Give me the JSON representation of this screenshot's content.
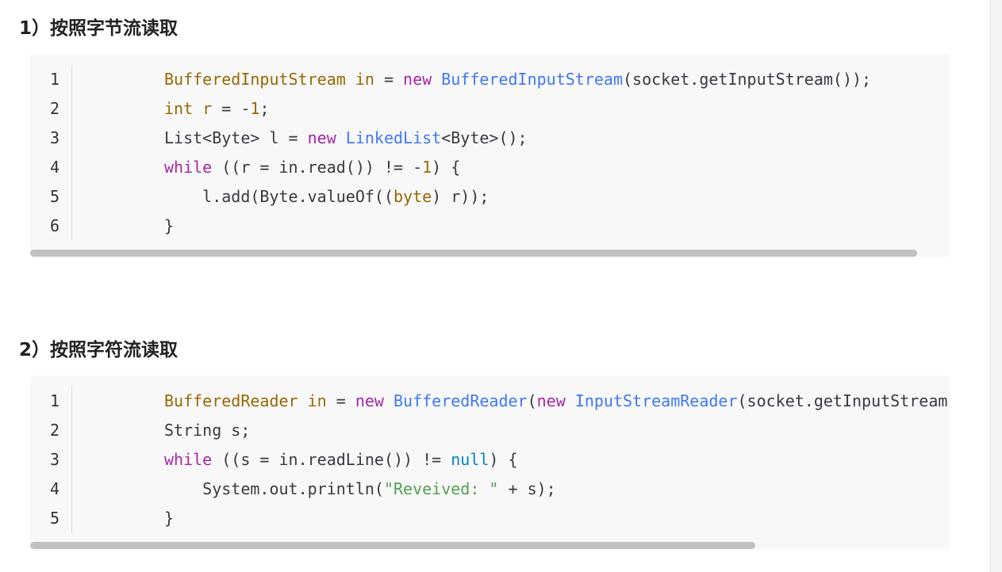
{
  "article": {
    "heading_1": "1）按照字节流读取",
    "heading_2": "2）按照字符流读取"
  },
  "code_blocks": [
    {
      "line_numbers": [
        "1",
        "2",
        "3",
        "4",
        "5",
        "6"
      ],
      "lines": [
        [
          [
            "tok-type",
            "BufferedInputStream"
          ],
          [
            "tok-plain",
            " "
          ],
          [
            "tok-var",
            "in"
          ],
          [
            "tok-plain",
            " = "
          ],
          [
            "tok-kw",
            "new"
          ],
          [
            "tok-plain",
            " "
          ],
          [
            "tok-cls",
            "BufferedInputStream"
          ],
          [
            "tok-plain",
            "(socket.getInputStream());"
          ]
        ],
        [
          [
            "tok-type",
            "int"
          ],
          [
            "tok-plain",
            " "
          ],
          [
            "tok-var",
            "r"
          ],
          [
            "tok-plain",
            " = -"
          ],
          [
            "tok-num",
            "1"
          ],
          [
            "tok-plain",
            ";"
          ]
        ],
        [
          [
            "tok-plain",
            "List<Byte> l = "
          ],
          [
            "tok-kw",
            "new"
          ],
          [
            "tok-plain",
            " "
          ],
          [
            "tok-cls",
            "LinkedList"
          ],
          [
            "tok-plain",
            "<Byte>();"
          ]
        ],
        [
          [
            "tok-kw",
            "while"
          ],
          [
            "tok-plain",
            " ((r = in.read()) != -"
          ],
          [
            "tok-num",
            "1"
          ],
          [
            "tok-plain",
            ") {"
          ]
        ],
        [
          [
            "tok-plain",
            "    l.add(Byte.valueOf(("
          ],
          [
            "tok-type",
            "byte"
          ],
          [
            "tok-plain",
            ") r));"
          ]
        ],
        [
          [
            "tok-plain",
            "}"
          ]
        ]
      ]
    },
    {
      "line_numbers": [
        "1",
        "2",
        "3",
        "4",
        "5"
      ],
      "lines": [
        [
          [
            "tok-type",
            "BufferedReader"
          ],
          [
            "tok-plain",
            " "
          ],
          [
            "tok-var",
            "in"
          ],
          [
            "tok-plain",
            " = "
          ],
          [
            "tok-kw",
            "new"
          ],
          [
            "tok-plain",
            " "
          ],
          [
            "tok-cls",
            "BufferedReader"
          ],
          [
            "tok-plain",
            "("
          ],
          [
            "tok-kw",
            "new"
          ],
          [
            "tok-plain",
            " "
          ],
          [
            "tok-cls",
            "InputStreamReader"
          ],
          [
            "tok-plain",
            "(socket.getInputStream()));"
          ]
        ],
        [
          [
            "tok-plain",
            "String s;"
          ]
        ],
        [
          [
            "tok-kw",
            "while"
          ],
          [
            "tok-plain",
            " ((s = in.readLine()) != "
          ],
          [
            "tok-null",
            "null"
          ],
          [
            "tok-plain",
            ") {"
          ]
        ],
        [
          [
            "tok-plain",
            "    System.out.println("
          ],
          [
            "tok-str",
            "\"Reveived: \""
          ],
          [
            "tok-plain",
            " + s);"
          ]
        ],
        [
          [
            "tok-plain",
            "}"
          ]
        ]
      ]
    }
  ],
  "scrollbars": [
    {
      "position_fraction": 0.0,
      "visible_fraction": 0.965
    },
    {
      "position_fraction": 0.0,
      "visible_fraction": 0.789
    }
  ]
}
